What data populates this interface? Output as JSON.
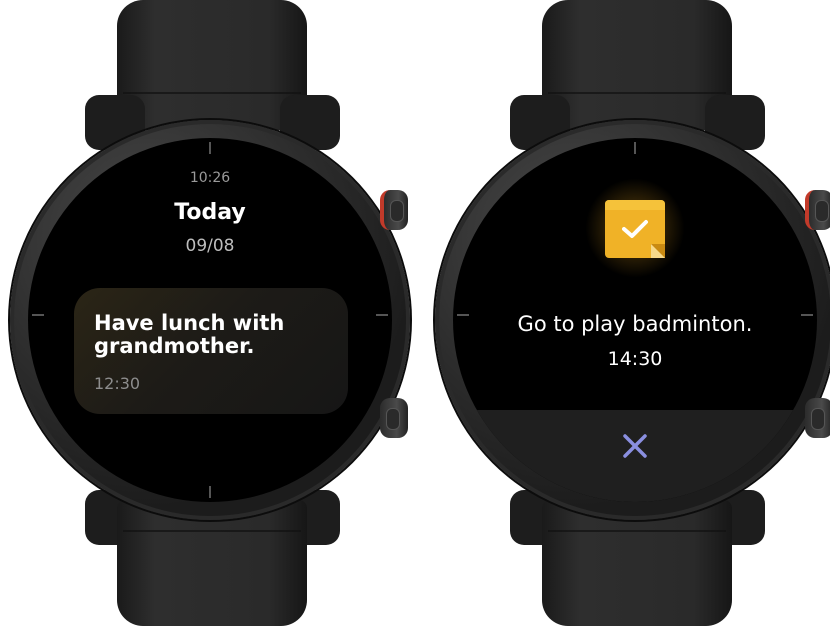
{
  "watch_left": {
    "time": "10:26",
    "day": "Today",
    "date": "09/08",
    "reminder": {
      "text": "Have lunch with grandmother.",
      "time": "12:30"
    }
  },
  "watch_right": {
    "icon": "sticky-note-check-icon",
    "message": "Go to play badminton.",
    "time": "14:30",
    "dismiss_icon": "close-icon"
  },
  "colors": {
    "note_yellow": "#f0b227",
    "dismiss_x": "#8a8fe0",
    "crown_accent": "#c23a2a"
  }
}
